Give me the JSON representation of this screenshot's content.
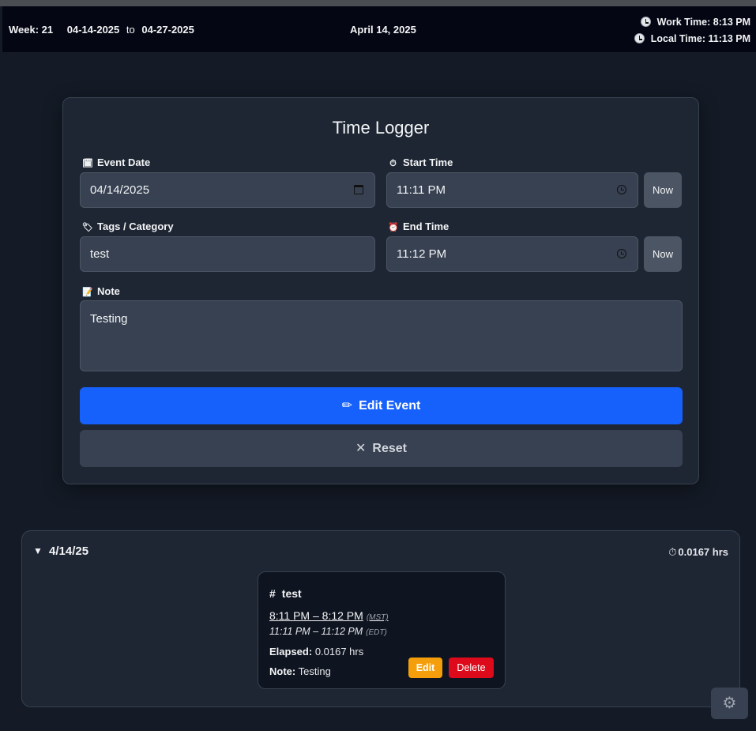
{
  "header": {
    "week_label": "Week: 21",
    "range_start": "04-14-2025",
    "range_to": "to",
    "range_end": "04-27-2025",
    "current_date": "April 14, 2025",
    "work_time": "Work Time: 8:13 PM",
    "local_time": "Local Time: 11:13 PM"
  },
  "form": {
    "title": "Time Logger",
    "event_date_label": "Event Date",
    "event_date_value": "04/14/2025",
    "start_time_label": "Start Time",
    "start_time_value": "11:11 PM",
    "end_time_label": "End Time",
    "end_time_value": "11:12 PM",
    "now_label": "Now",
    "tags_label": "Tags / Category",
    "tags_value": "test",
    "note_label": "Note",
    "note_value": "Testing",
    "edit_button": "Edit Event",
    "reset_button": "Reset"
  },
  "day": {
    "toggle": "▼",
    "label": "4/14/25",
    "total": "0.0167 hrs",
    "entries": [
      {
        "hash": "#",
        "tag": "test",
        "mst_range": "8:11 PM – 8:12 PM",
        "mst_tz": "(MST)",
        "edt_range": "11:11 PM – 11:12 PM",
        "edt_tz": "(EDT)",
        "elapsed_label": "Elapsed:",
        "elapsed_value": "0.0167 hrs",
        "note_label": "Note:",
        "note_value": "Testing",
        "edit_label": "Edit",
        "delete_label": "Delete"
      }
    ]
  },
  "icons": {
    "calendar": "🗓",
    "stopwatch": "⏱",
    "tag": "🏷",
    "alarm": "⏰",
    "memo": "📝",
    "pencil": "✏",
    "close": "✕",
    "gear": "⚙"
  },
  "colors": {
    "primary": "#1660fb",
    "edit": "#f59e0b",
    "delete": "#dc0a1a",
    "background": "#141b26",
    "header": "#040713"
  }
}
